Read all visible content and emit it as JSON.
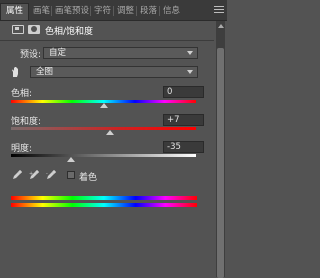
{
  "tabs": [
    {
      "label": "属性",
      "active": true
    },
    {
      "label": "画笔",
      "active": false
    },
    {
      "label": "画笔预设",
      "active": false
    },
    {
      "label": "字符",
      "active": false
    },
    {
      "label": "调整",
      "active": false
    },
    {
      "label": "段落",
      "active": false
    },
    {
      "label": "信息",
      "active": false
    }
  ],
  "properties": {
    "title": "色相/饱和度",
    "preset_label": "预设:",
    "preset_value": "自定",
    "channel_value": "全图"
  },
  "hue": {
    "label": "色相:",
    "value": "0",
    "level": 0.5
  },
  "saturation": {
    "label": "饱和度:",
    "value": "+7",
    "level": 0.535
  },
  "lightness": {
    "label": "明度:",
    "value": "-35",
    "level": 0.325
  },
  "colorize": {
    "label": "着色",
    "checked": false
  },
  "colors": {
    "panel_bg": "#535353",
    "tab_bg": "#3a3a3a",
    "accent_text": "#ffffff"
  }
}
